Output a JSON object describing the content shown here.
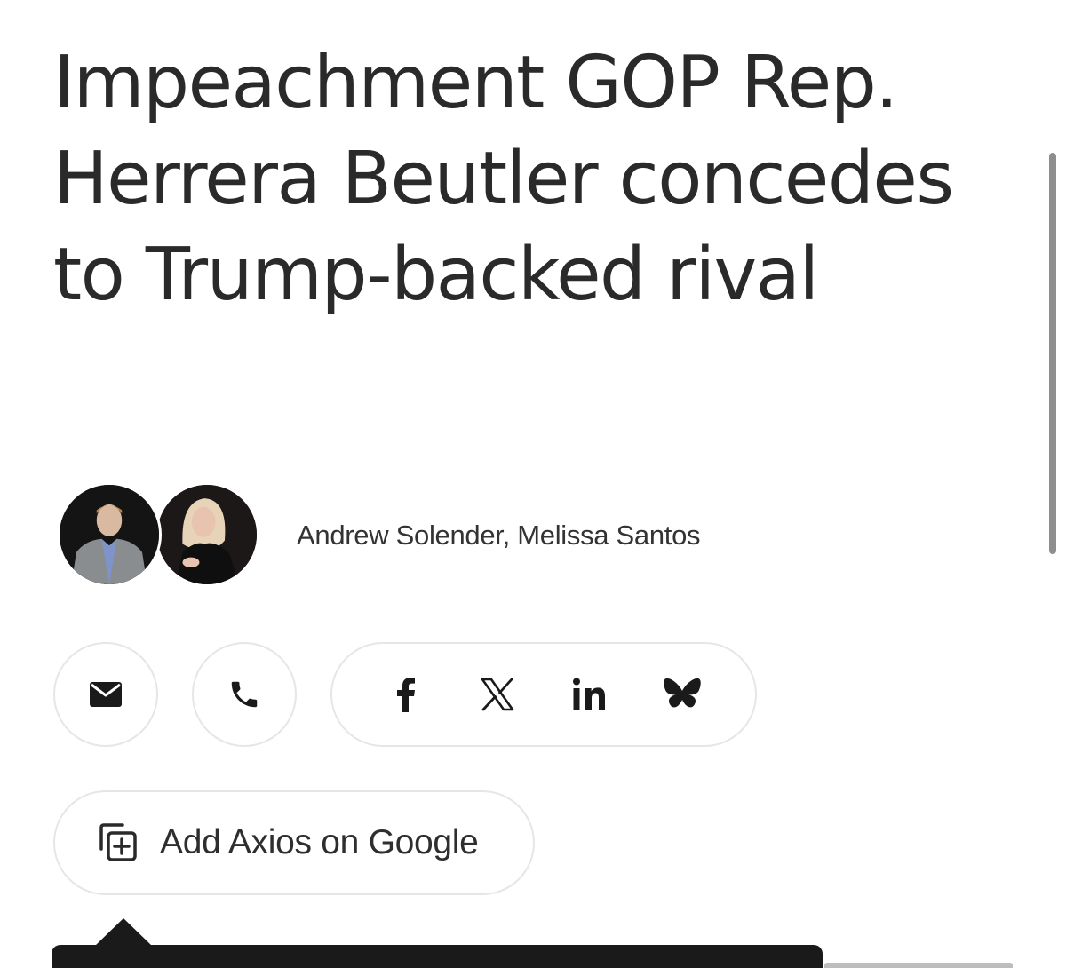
{
  "article": {
    "headline": "Impeachment GOP Rep. Herrera Beutler concedes to Trump-backed rival",
    "byline": "Andrew Solender, Melissa Santos",
    "authors": [
      {
        "name": "Andrew Solender",
        "avatar_icon": "author-photo"
      },
      {
        "name": "Melissa Santos",
        "avatar_icon": "author-photo"
      }
    ]
  },
  "share": {
    "email_icon": "envelope-icon",
    "phone_icon": "phone-icon",
    "social": [
      {
        "name": "facebook",
        "icon": "facebook-icon"
      },
      {
        "name": "x",
        "icon": "x-icon"
      },
      {
        "name": "linkedin",
        "icon": "linkedin-icon"
      },
      {
        "name": "bluesky",
        "icon": "bluesky-icon"
      }
    ]
  },
  "google_button": {
    "label": "Add Axios on Google",
    "icon": "add-source-icon"
  },
  "colors": {
    "text": "#2a2a2a",
    "border": "#e6e6e6",
    "tooltip": "#1a1a1a"
  }
}
